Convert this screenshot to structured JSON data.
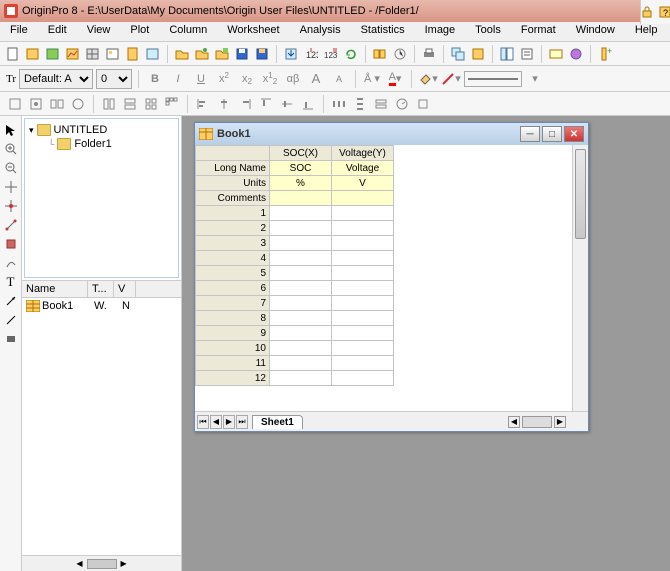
{
  "titlebar": {
    "app_and_path": "OriginPro 8 - E:\\UserData\\My Documents\\Origin User Files\\UNTITLED - /Folder1/"
  },
  "menu": {
    "file": "File",
    "edit": "Edit",
    "view": "View",
    "plot": "Plot",
    "column": "Column",
    "worksheet": "Worksheet",
    "analysis": "Analysis",
    "statistics": "Statistics",
    "image": "Image",
    "tools": "Tools",
    "format": "Format",
    "window": "Window",
    "help": "Help"
  },
  "format_toolbar": {
    "font_label_prefix": "Tr",
    "font_name": "Default: A",
    "font_size": "0"
  },
  "navigator": {
    "root": "UNTITLED",
    "folder": "Folder1",
    "grid_headers": {
      "name": "Name",
      "type": "T...",
      "view": "V"
    },
    "book_entry": {
      "name": "Book1",
      "type": "W.",
      "view": "N"
    }
  },
  "mdi_window": {
    "title": "Book1",
    "columns": [
      {
        "header": "SOC(X)",
        "long_name": "SOC",
        "units": "%",
        "comments": ""
      },
      {
        "header": "Voltage(Y)",
        "long_name": "Voltage",
        "units": "V",
        "comments": ""
      }
    ],
    "row_labels": {
      "long_name": "Long Name",
      "units": "Units",
      "comments": "Comments"
    },
    "data_row_count": 12,
    "sheet_tab": "Sheet1"
  }
}
